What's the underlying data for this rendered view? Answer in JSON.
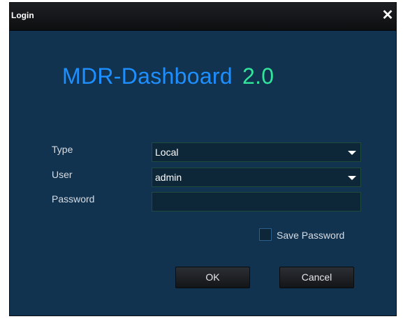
{
  "window": {
    "title": "Login",
    "close_icon": "close-icon"
  },
  "app": {
    "name": "MDR-Dashboard",
    "version": "2.0"
  },
  "form": {
    "type_label": "Type",
    "type_value": "Local",
    "user_label": "User",
    "user_value": "admin",
    "password_label": "Password",
    "password_value": "",
    "save_password_label": "Save Password",
    "save_password_checked": false
  },
  "buttons": {
    "ok": "OK",
    "cancel": "Cancel"
  },
  "colors": {
    "background": "#113350",
    "app_name": "#1e8fff",
    "app_version": "#31e59a",
    "field_border": "#1f4b3d"
  }
}
